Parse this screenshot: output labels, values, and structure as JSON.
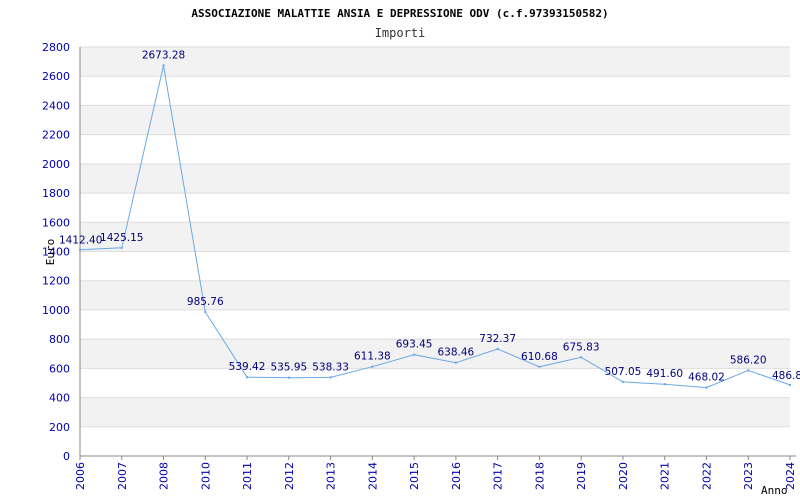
{
  "chart_data": {
    "type": "line",
    "title": "ASSOCIAZIONE MALATTIE ANSIA E DEPRESSIONE ODV (c.f.97393150582)",
    "subtitle": "Importi",
    "xlabel": "Anno",
    "ylabel": "Euro",
    "categories": [
      "2006",
      "2007",
      "2008",
      "2010",
      "2011",
      "2012",
      "2013",
      "2014",
      "2015",
      "2016",
      "2017",
      "2018",
      "2019",
      "2020",
      "2021",
      "2022",
      "2023",
      "2024"
    ],
    "values": [
      1412.4,
      1425.15,
      2673.28,
      985.76,
      539.42,
      535.95,
      538.33,
      611.38,
      693.45,
      638.46,
      732.37,
      610.68,
      675.83,
      507.05,
      491.6,
      468.02,
      586.2,
      486.8
    ],
    "value_labels": [
      "1412.40",
      "1425.15",
      "2673.28",
      "985.76",
      "539.42",
      "535.95",
      "538.33",
      "611.38",
      "693.45",
      "638.46",
      "732.37",
      "610.68",
      "675.83",
      "507.05",
      "491.60",
      "468.02",
      "586.20",
      "486.8"
    ],
    "y_ticks": [
      "0",
      "200",
      "400",
      "600",
      "800",
      "1000",
      "1200",
      "1400",
      "1600",
      "1800",
      "2000",
      "2200",
      "2400",
      "2600",
      "2800"
    ],
    "ylim": [
      0,
      2800
    ],
    "grid": true,
    "colors": {
      "line": "#6aaae6",
      "band": "#f2f2f2",
      "gridline": "#dddddd",
      "tick_text": "#0000aa",
      "label_text": "#00007a"
    }
  }
}
